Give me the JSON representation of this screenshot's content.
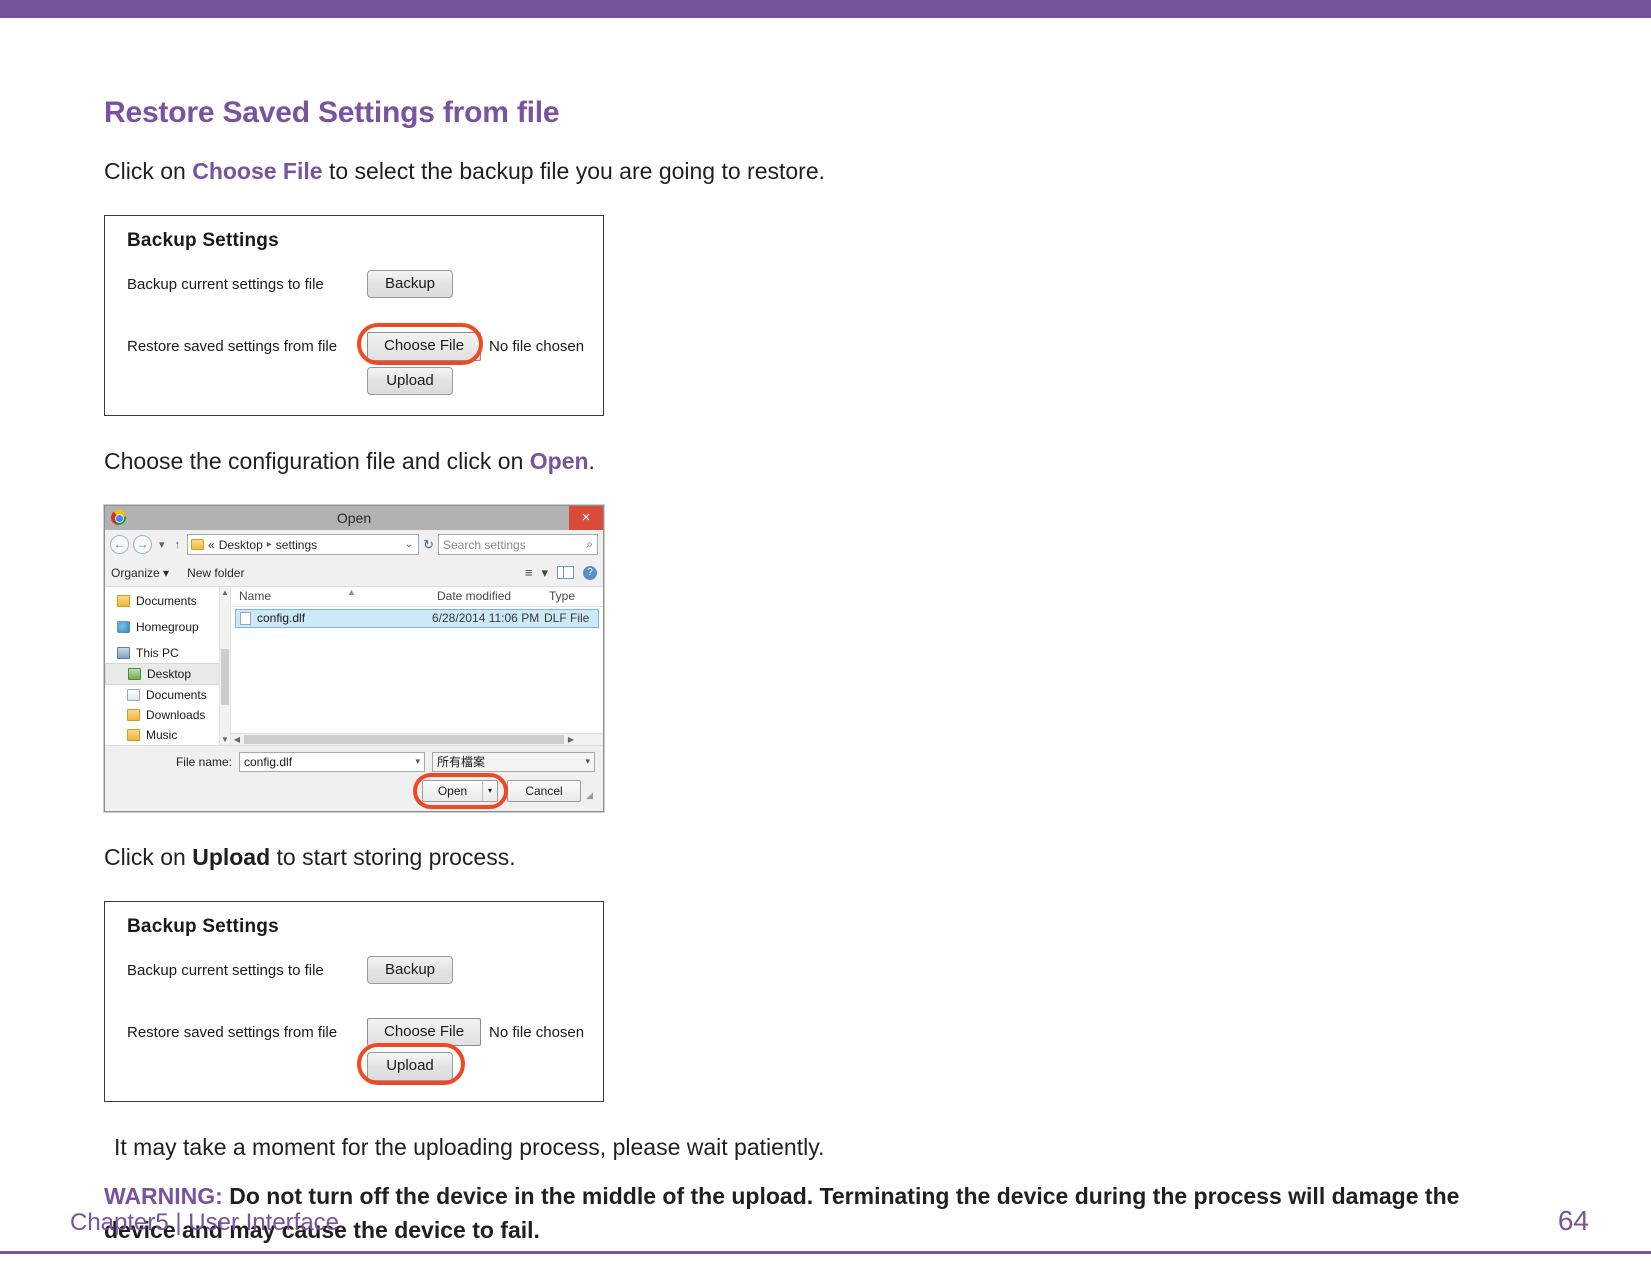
{
  "theme": {
    "accent_purple": "#74549b",
    "heading_purple": "#7a529e",
    "highlight_red": "#ef4923",
    "body_black": "#231f20"
  },
  "section": {
    "title": "Restore Saved Settings from file"
  },
  "steps": {
    "step1_prefix": "Click on ",
    "step1_bold": "Choose File",
    "step1_suffix": " to select the backup file you are going to restore.",
    "step2_prefix": "Choose the configuration file and click on ",
    "step2_bold": "Open",
    "step2_suffix": ".",
    "step3_prefix": "Click on ",
    "step3_bold": "Upload",
    "step3_suffix": " to start storing process."
  },
  "backup_panel_1": {
    "title": "Backup Settings",
    "row1_label": "Backup current settings to file",
    "row1_button": "Backup",
    "row2_label": "Restore saved settings from file",
    "row2_button": "Choose File",
    "row2_status": "No file chosen",
    "row3_button": "Upload",
    "highlight": "choose-file"
  },
  "backup_panel_2": {
    "title": "Backup Settings",
    "row1_label": "Backup current settings to file",
    "row1_button": "Backup",
    "row2_label": "Restore saved settings from file",
    "row2_button": "Choose File",
    "row2_status": "No file chosen",
    "row3_button": "Upload",
    "highlight": "upload"
  },
  "open_dialog": {
    "title": "Open",
    "close_label": "×",
    "nav": {
      "back": "←",
      "forward": "→",
      "history_caret": "▾",
      "up": "↑",
      "breadcrumb_prefix": "«",
      "breadcrumb": [
        "Desktop",
        "settings"
      ],
      "breadcrumb_sep": "▸",
      "dropdown_caret": "⌄",
      "refresh": "↻",
      "search_placeholder": "Search settings",
      "search_icon": "⌕"
    },
    "toolbar": {
      "organize": "Organize",
      "organize_caret": "▾",
      "new_folder": "New folder",
      "view_caret": "▾",
      "help": "?"
    },
    "sidebar_items": [
      {
        "label": "Documents",
        "icon": "folder-icon",
        "indent": false,
        "selected": false
      },
      {
        "label": "Homegroup",
        "icon": "homegroup-icon",
        "indent": false,
        "selected": false
      },
      {
        "label": "This PC",
        "icon": "this-pc-icon",
        "indent": false,
        "selected": false
      },
      {
        "label": "Desktop",
        "icon": "desktop-icon",
        "indent": true,
        "selected": true
      },
      {
        "label": "Documents",
        "icon": "documents-icon",
        "indent": true,
        "selected": false
      },
      {
        "label": "Downloads",
        "icon": "downloads-icon",
        "indent": true,
        "selected": false
      },
      {
        "label": "Music",
        "icon": "music-icon",
        "indent": true,
        "selected": false
      }
    ],
    "file_columns": [
      "Name",
      "Date modified",
      "Type"
    ],
    "files": [
      {
        "name": "config.dlf",
        "date": "6/28/2014 11:06 PM",
        "type": "DLF File",
        "selected": true
      }
    ],
    "footer": {
      "file_name_label": "File name:",
      "file_name_value": "config.dlf",
      "filter_value": "所有檔案",
      "open_button": "Open",
      "open_caret": "▾",
      "cancel_button": "Cancel"
    },
    "highlight": "open-button"
  },
  "notes": {
    "patience": "It may take a moment for the uploading process, please wait patiently.",
    "warning_label": "WARNING:",
    "warning_text": " Do not turn off the device in the middle of the upload. Terminating the device during the process will damage the device and may cause the device to fail."
  },
  "footer": {
    "chapter": "Chapter5  |  User Interface",
    "page_number": "64"
  }
}
